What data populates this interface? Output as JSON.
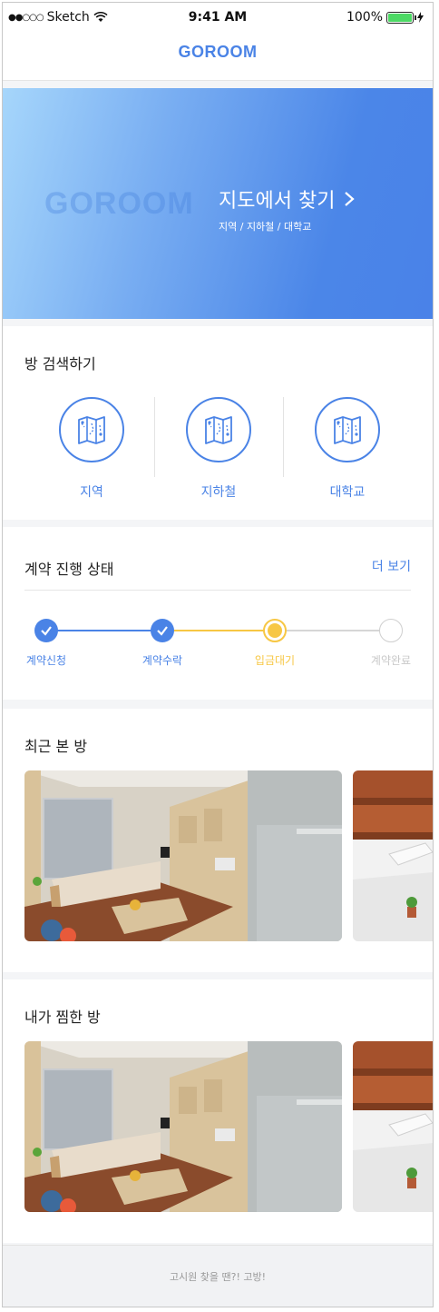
{
  "status_bar": {
    "signal": "●●○○○",
    "carrier": "Sketch",
    "time": "9:41 AM",
    "battery": "100%"
  },
  "header": {
    "brand": "GOROOM"
  },
  "banner": {
    "watermark": "GOROOM",
    "title": "지도에서 찾기",
    "subtitle": "지역 / 지하철 / 대학교"
  },
  "search": {
    "title": "방 검색하기",
    "items": [
      {
        "label": "지역",
        "icon": "map-icon"
      },
      {
        "label": "지하철",
        "icon": "map-icon"
      },
      {
        "label": "대학교",
        "icon": "map-icon"
      }
    ]
  },
  "contract": {
    "title": "계약 진행 상태",
    "more_label": "더 보기",
    "steps": [
      {
        "label": "계약신청",
        "status": "done"
      },
      {
        "label": "계약수락",
        "status": "done"
      },
      {
        "label": "입금대기",
        "status": "current"
      },
      {
        "label": "계약완료",
        "status": "pending"
      }
    ]
  },
  "recent": {
    "title": "최근 본 방"
  },
  "favorites": {
    "title": "내가 찜한 방"
  },
  "footer": {
    "text": "고시원 찾을 땐?! 고방!"
  },
  "colors": {
    "accent": "#4a83e6",
    "current_step": "#f7c744",
    "pending": "#d0d0d0"
  }
}
